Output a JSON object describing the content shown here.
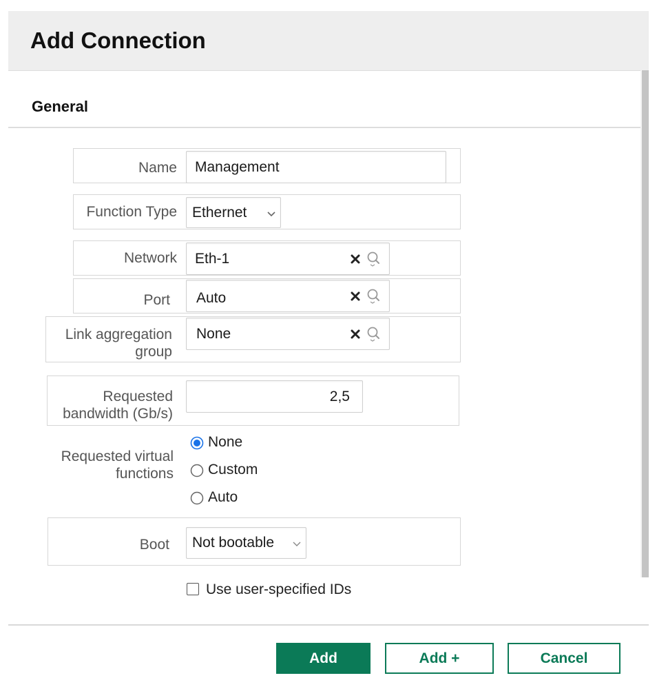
{
  "dialog": {
    "title": "Add Connection",
    "section": "General"
  },
  "form": {
    "name": {
      "label": "Name",
      "value": "Management"
    },
    "function_type": {
      "label": "Function Type",
      "value": "Ethernet",
      "icon": "chevron-down-icon"
    },
    "network": {
      "label": "Network",
      "value": "Eth-1",
      "clear_icon": "close-icon",
      "search_icon": "search-icon"
    },
    "port": {
      "label": "Port",
      "value": "Auto",
      "clear_icon": "close-icon",
      "search_icon": "search-icon"
    },
    "lag": {
      "label_line1": "Link aggregation",
      "label_line2": "group",
      "value": "None",
      "clear_icon": "close-icon",
      "search_icon": "search-icon"
    },
    "bandwidth": {
      "label_line1": "Requested",
      "label_line2": "bandwidth (Gb/s)",
      "value": "2,5"
    },
    "virtual_functions": {
      "label_line1": "Requested virtual",
      "label_line2": "functions",
      "options": [
        {
          "label": "None",
          "selected": true
        },
        {
          "label": "Custom",
          "selected": false
        },
        {
          "label": "Auto",
          "selected": false
        }
      ]
    },
    "boot": {
      "label": "Boot",
      "value": "Not bootable",
      "icon": "chevron-down-icon"
    },
    "user_ids": {
      "label": "Use user-specified IDs",
      "checked": false
    }
  },
  "footer": {
    "add": "Add",
    "add_plus": "Add +",
    "cancel": "Cancel"
  },
  "colors": {
    "primary": "#0b7a57",
    "radio_selected": "#1a73e8",
    "header_bg": "#eeeeee"
  }
}
